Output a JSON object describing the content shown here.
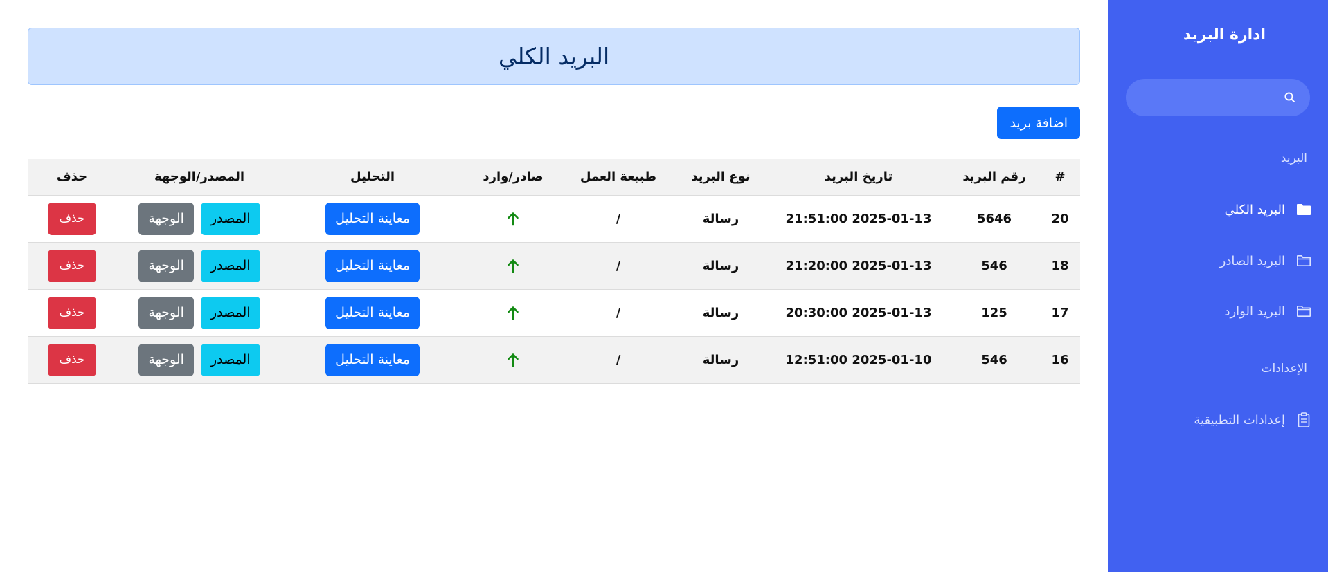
{
  "sidebar": {
    "brand": "ادارة البريد",
    "search": {
      "value": "",
      "placeholder": ""
    },
    "sections": [
      {
        "title": "البريد",
        "items": [
          {
            "label": "البريد الكلي",
            "icon": "folder-filled-icon",
            "active": true
          },
          {
            "label": "البريد الصادر",
            "icon": "folder-outline-icon",
            "active": false
          },
          {
            "label": "البريد الوارد",
            "icon": "folder-outline-icon",
            "active": false
          }
        ]
      },
      {
        "title": "الإعدادات",
        "items": [
          {
            "label": "إعدادات التطبيقية",
            "icon": "clipboard-icon",
            "active": false
          }
        ]
      }
    ]
  },
  "header": {
    "title": "البريد الكلي"
  },
  "toolbar": {
    "add_label": "اضافة بريد"
  },
  "table": {
    "columns": [
      "#",
      "رقم البريد",
      "تاريخ البريد",
      "نوع البريد",
      "طبيعة العمل",
      "صادر/وارد",
      "التحليل",
      "المصدر/الوجهة",
      "حذف"
    ],
    "rows": [
      {
        "num": "20",
        "mail_id": "5646",
        "date": "2025-01-13 21:51:00",
        "type": "رسالة",
        "nature": "/",
        "direction": "outgoing",
        "analysis_label": "معاينة التحليل",
        "source_label": "المصدر",
        "dest_label": "الوجهة",
        "delete_label": "حذف"
      },
      {
        "num": "18",
        "mail_id": "546",
        "date": "2025-01-13 21:20:00",
        "type": "رسالة",
        "nature": "/",
        "direction": "outgoing",
        "analysis_label": "معاينة التحليل",
        "source_label": "المصدر",
        "dest_label": "الوجهة",
        "delete_label": "حذف"
      },
      {
        "num": "17",
        "mail_id": "125",
        "date": "2025-01-13 20:30:00",
        "type": "رسالة",
        "nature": "/",
        "direction": "outgoing",
        "analysis_label": "معاينة التحليل",
        "source_label": "المصدر",
        "dest_label": "الوجهة",
        "delete_label": "حذف"
      },
      {
        "num": "16",
        "mail_id": "546",
        "date": "2025-01-10 12:51:00",
        "type": "رسالة",
        "nature": "/",
        "direction": "outgoing",
        "analysis_label": "معاينة التحليل",
        "source_label": "المصدر",
        "dest_label": "الوجهة",
        "delete_label": "حذف"
      }
    ]
  },
  "colors": {
    "sidebar_bg": "#4161f1",
    "primary": "#0d6efd",
    "info": "#0dcaf0",
    "secondary": "#6c757d",
    "danger": "#dc3545",
    "arrow": "#138a13",
    "header_bg": "#cfe2ff"
  }
}
